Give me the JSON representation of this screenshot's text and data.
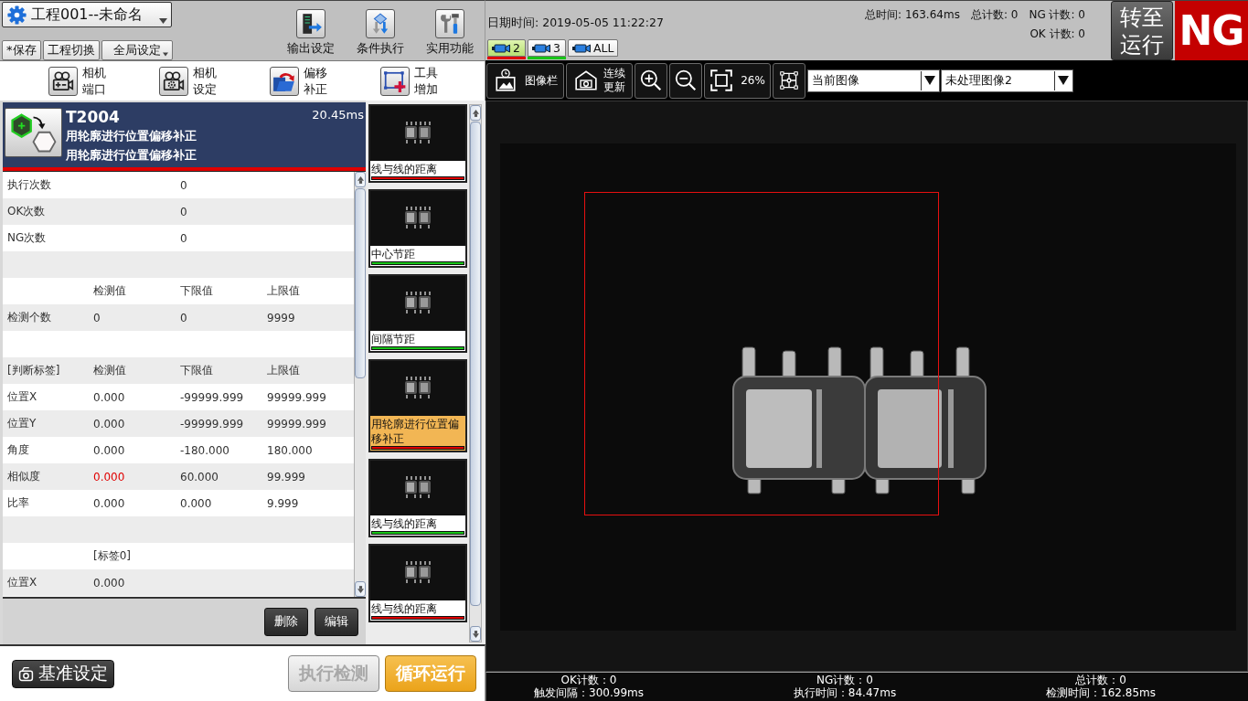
{
  "project": {
    "title": "工程001--未命名"
  },
  "file_buttons": [
    {
      "label": "*保存",
      "kind": "plain"
    },
    {
      "label": "工程切换",
      "kind": "plain"
    },
    {
      "label": "全局设定",
      "kind": "menu"
    }
  ],
  "top_tools": [
    {
      "label": "输出设定",
      "kind": "output"
    },
    {
      "label": "条件执行",
      "kind": "branch"
    },
    {
      "label": "实用功能",
      "kind": "tools"
    }
  ],
  "datetime": "日期时间: 2019-05-05 11:22:27",
  "camera_tabs": [
    {
      "label": "2",
      "selected": true,
      "ok": false
    },
    {
      "label": "3",
      "selected": false,
      "ok": true
    },
    {
      "label": "ALL",
      "selected": false
    }
  ],
  "counters": [
    {
      "items": [
        "总时间: 163.64ms",
        "总计数: 0",
        "NG 计数: 0"
      ]
    },
    {
      "items": [
        "OK 计数: 0"
      ]
    }
  ],
  "run_button": {
    "label": "转至运行"
  },
  "result_badge": {
    "label": "NG",
    "ok": false
  },
  "camera_tools": [
    {
      "label": "相机端口",
      "kind": "camera-port"
    },
    {
      "label": "相机设定",
      "kind": "camera-settings"
    },
    {
      "label": "偏移补正",
      "kind": "offset"
    },
    {
      "label": "工具增加",
      "kind": "add-tool"
    }
  ],
  "view_toolbar": {
    "buttons": [
      {
        "kind": "image-bar",
        "label": "图像栏"
      },
      {
        "kind": "refresh",
        "label": "连续更新"
      },
      {
        "kind": "zoom-in"
      },
      {
        "kind": "zoom-out"
      },
      {
        "kind": "fit",
        "label": "26%"
      },
      {
        "kind": "region"
      }
    ],
    "dropdowns": [
      {
        "value": "当前图像"
      },
      {
        "value": "未处理图像2"
      }
    ]
  },
  "tool_header": {
    "id": "T2004",
    "time": "20.45ms",
    "lines": [
      "用轮廓进行位置偏移补正",
      "用轮廓进行位置偏移补正"
    ],
    "ok": false
  },
  "result_table": {
    "rows": [
      {
        "kind": "data",
        "cells": [
          "执行次数",
          null,
          "0"
        ]
      },
      {
        "kind": "data",
        "cells": [
          "OK次数",
          null,
          "0"
        ]
      },
      {
        "kind": "data",
        "cells": [
          "NG次数",
          null,
          "0"
        ]
      },
      {
        "kind": "blank"
      },
      {
        "kind": "data",
        "cells": [
          null,
          "检测值",
          "下限值",
          "上限值"
        ]
      },
      {
        "kind": "data",
        "cells": [
          "检测个数",
          "0",
          "0",
          "9999"
        ],
        "ng": false
      },
      {
        "kind": "blank"
      },
      {
        "kind": "data",
        "cells": [
          "[判断标签]",
          "检测值",
          "下限值",
          "上限值"
        ]
      },
      {
        "kind": "data",
        "cells": [
          "位置X",
          "0.000",
          "-99999.999",
          "99999.999"
        ],
        "ng": false
      },
      {
        "kind": "data",
        "cells": [
          "位置Y",
          "0.000",
          "-99999.999",
          "99999.999"
        ],
        "ng": false
      },
      {
        "kind": "data",
        "cells": [
          "角度",
          "0.000",
          "-180.000",
          "180.000"
        ],
        "ng": false
      },
      {
        "kind": "data",
        "cells": [
          "相似度",
          "0.000",
          "60.000",
          "99.999"
        ],
        "ng": true
      },
      {
        "kind": "data",
        "cells": [
          "比率",
          "0.000",
          "0.000",
          "9.999"
        ],
        "ng": false
      },
      {
        "kind": "blank"
      },
      {
        "kind": "data",
        "cells": [
          null,
          "[标签0]"
        ]
      },
      {
        "kind": "data",
        "cells": [
          "位置X",
          "0.000"
        ],
        "ng": false
      }
    ]
  },
  "table_buttons": [
    {
      "label": "删除"
    },
    {
      "label": "编辑"
    }
  ],
  "tool_list": [
    {
      "label": "线与线的距离",
      "ok": false,
      "selected": false
    },
    {
      "label": "中心节距",
      "ok": true,
      "selected": false
    },
    {
      "label": "间隔节距",
      "ok": true,
      "selected": false
    },
    {
      "label": "用轮廓进行位置偏移补正",
      "ok": false,
      "selected": true
    },
    {
      "label": "线与线的距离",
      "ok": true,
      "selected": false
    },
    {
      "label": "线与线的距离",
      "ok": false,
      "selected": false
    }
  ],
  "bottom_buttons": [
    {
      "label": "基准设定",
      "kind": "reference",
      "disabled": false
    },
    {
      "label": "执行检测",
      "kind": "run-once",
      "disabled": true
    },
    {
      "label": "循环运行",
      "kind": "loop",
      "disabled": false
    }
  ],
  "status_bar": [
    {
      "lines": [
        "OK计数：0",
        "触发间隔：300.99ms"
      ]
    },
    {
      "lines": [
        "NG计数：0",
        "执行时间：84.47ms"
      ]
    },
    {
      "lines": [
        "总计数：0",
        "检测时间：162.85ms"
      ]
    }
  ]
}
